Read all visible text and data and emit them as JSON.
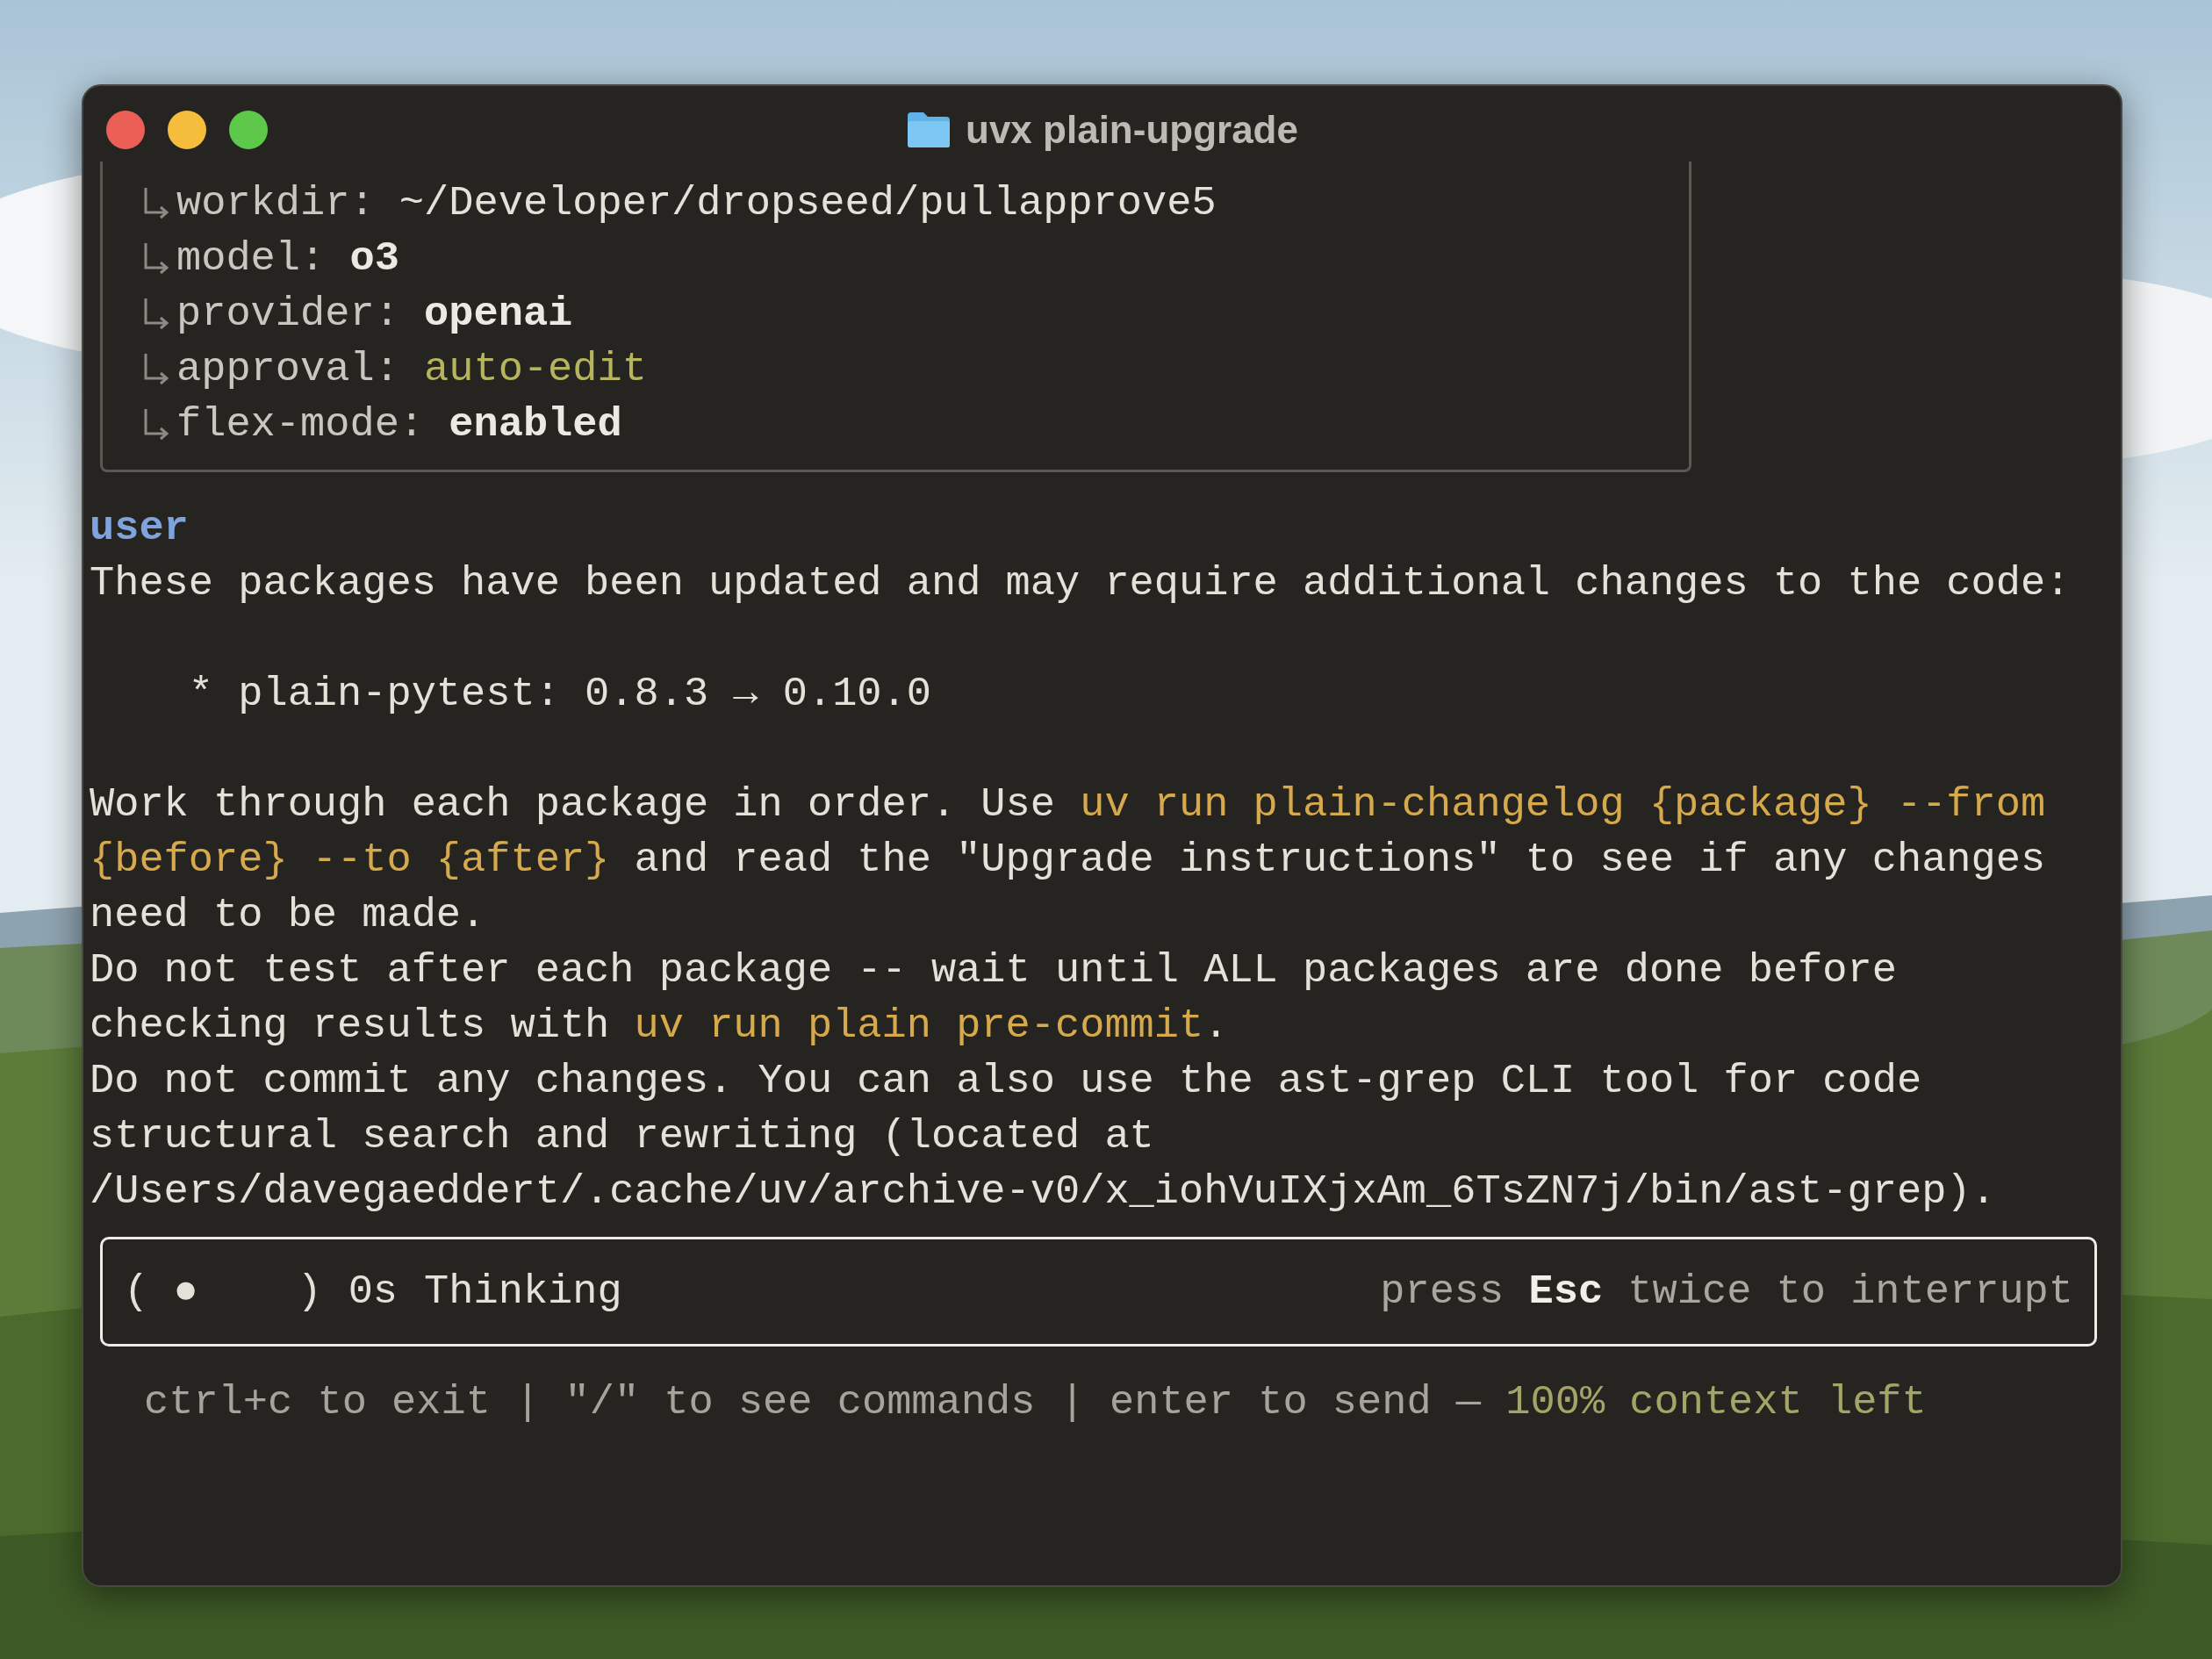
{
  "window": {
    "title": "uvx plain-upgrade"
  },
  "config": [
    {
      "key": "workdir:",
      "value": "~/Developer/dropseed/pullapprove5",
      "kind": "path"
    },
    {
      "key": "model:",
      "value": "o3",
      "kind": "bold"
    },
    {
      "key": "provider:",
      "value": "openai",
      "kind": "bold"
    },
    {
      "key": "approval:",
      "value": "auto-edit",
      "kind": "accent"
    },
    {
      "key": "flex-mode:",
      "value": "enabled",
      "kind": "bold"
    }
  ],
  "message": {
    "role": "user",
    "lines": [
      [
        {
          "text": "These packages have been updated and may require additional changes to the code:",
          "kind": "plain"
        }
      ],
      [
        {
          "text": "    * plain-pytest: 0.8.3 → 0.10.0",
          "kind": "gap"
        }
      ],
      [
        {
          "text": "Work through each package in order. Use ",
          "kind": "gap"
        },
        {
          "text": "uv run plain-changelog {package} --from",
          "kind": "code"
        }
      ],
      [
        {
          "text": "{before} --to {after}",
          "kind": "code"
        },
        {
          "text": " and read the \"Upgrade instructions\" to see if any changes",
          "kind": "plain"
        }
      ],
      [
        {
          "text": "need to be made.",
          "kind": "plain"
        }
      ],
      [
        {
          "text": "Do not test after each package -- wait until ALL packages are done before",
          "kind": "plain"
        }
      ],
      [
        {
          "text": "checking results with ",
          "kind": "plain"
        },
        {
          "text": "uv run plain pre-commit",
          "kind": "code"
        },
        {
          "text": ".",
          "kind": "plain"
        }
      ],
      [
        {
          "text": "Do not commit any changes. You can also use the ast-grep CLI tool for code",
          "kind": "plain"
        }
      ],
      [
        {
          "text": "structural search and rewriting (located at",
          "kind": "plain"
        }
      ],
      [
        {
          "text": "/Users/davegaeddert/.cache/uv/archive-v0/x_iohVuIXjxAm_6TsZN7j/bin/ast-grep).",
          "kind": "plain"
        }
      ]
    ]
  },
  "status": {
    "spinner": "( ●    )",
    "elapsed": "0s",
    "label": "Thinking",
    "hint": "press **Esc** twice to interrupt"
  },
  "footer": {
    "help": "ctrl+c to exit | \"/\" to see commands | enter to send — ",
    "context": "100% context left"
  }
}
